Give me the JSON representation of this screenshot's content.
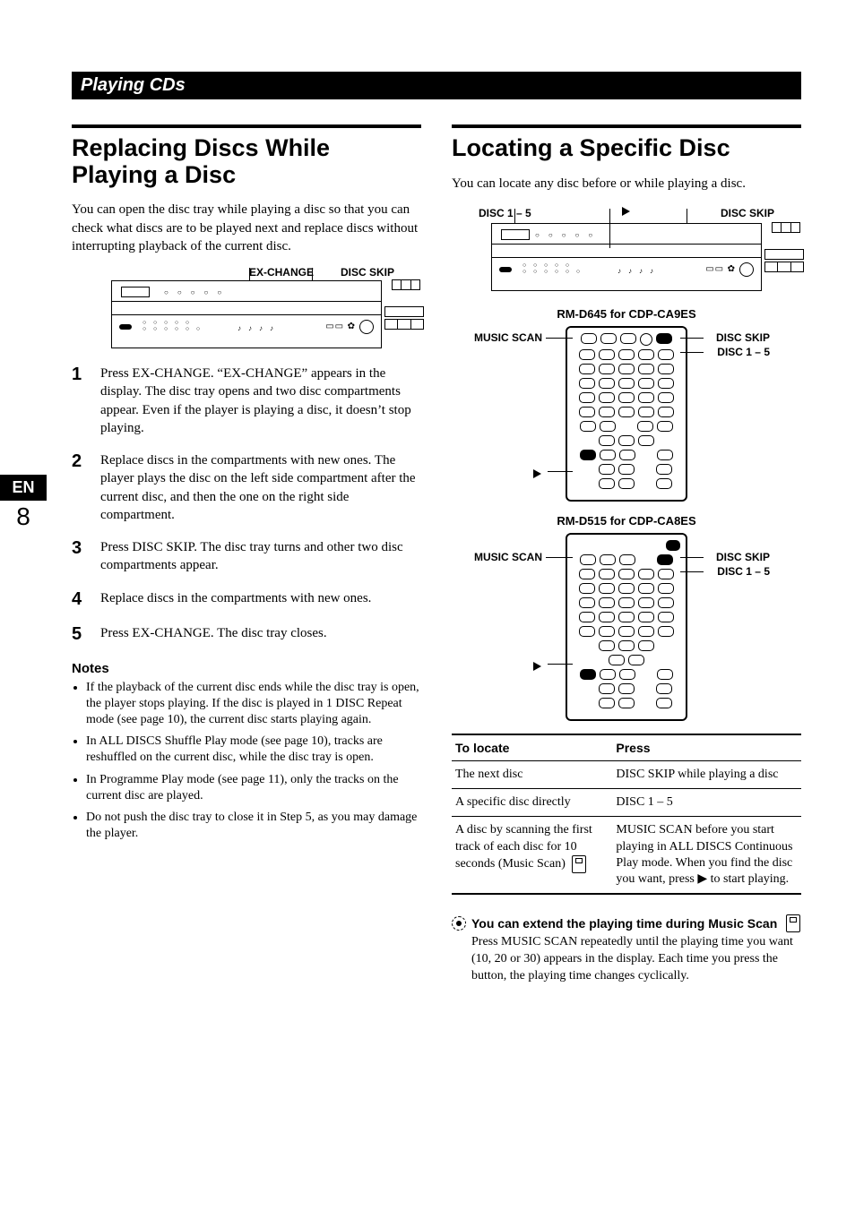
{
  "section_bar": "Playing CDs",
  "side": {
    "lang": "EN",
    "page": "8"
  },
  "left": {
    "title": "Replacing Discs While Playing a Disc",
    "intro": "You can open the disc tray while playing a disc so that you can check what discs are to be played next and replace discs without interrupting playback of the current disc.",
    "callouts": {
      "a": "EX-CHANGE",
      "b": "DISC SKIP"
    },
    "steps": [
      {
        "n": "1",
        "t": "Press EX-CHANGE.\n“EX-CHANGE” appears in the display. The disc tray opens and two disc compartments appear. Even if the player is playing a disc, it doesn’t stop playing."
      },
      {
        "n": "2",
        "t": "Replace discs in the compartments with new ones. The player plays the disc on the left side compartment after the current disc, and then the one on the right side compartment."
      },
      {
        "n": "3",
        "t": "Press DISC SKIP.\nThe disc tray turns and other two disc compartments appear."
      },
      {
        "n": "4",
        "t": "Replace discs in the compartments with new ones."
      },
      {
        "n": "5",
        "t": "Press EX-CHANGE.\nThe disc tray closes."
      }
    ],
    "notes_head": "Notes",
    "notes": [
      "If the playback of the current disc ends while the disc tray is open, the player stops playing. If the disc is played in 1 DISC Repeat mode (see page 10), the current disc starts playing again.",
      "In ALL DISCS Shuffle Play mode (see page 10), tracks are reshuffled on the current disc, while the disc tray is open.",
      "In Programme Play mode (see page 11), only the tracks on the current disc are played.",
      "Do not push the disc tray to close it in Step 5, as you may damage the player."
    ]
  },
  "right": {
    "title": "Locating a Specific Disc",
    "intro": "You can locate any disc before or while playing a disc.",
    "panel_callouts": {
      "left": "DISC 1 – 5",
      "right": "DISC SKIP"
    },
    "remote1_title": "RM-D645 for CDP-CA9ES",
    "remote2_title": "RM-D515 for CDP-CA8ES",
    "rc_labels": {
      "music_scan": "MUSIC SCAN",
      "disc_skip": "DISC SKIP",
      "disc15": "DISC 1 – 5",
      "play": "▶"
    },
    "table": {
      "head": {
        "a": "To locate",
        "b": "Press"
      },
      "rows": [
        {
          "a": "The next disc",
          "b": "DISC SKIP while playing a disc"
        },
        {
          "a": "A specific disc directly",
          "b": "DISC 1 – 5"
        },
        {
          "a": "A disc by scanning the first track of each disc for 10 seconds (Music Scan) ",
          "b": "MUSIC SCAN before you start playing in ALL DISCS Continuous Play mode. When you find the disc you want, press ▶ to start playing."
        }
      ]
    },
    "tip": {
      "head": "You can extend the playing time during Music Scan ",
      "body": "Press MUSIC SCAN repeatedly until the playing time you want (10, 20 or 30) appears in the display. Each time you press the button, the playing time changes cyclically."
    }
  }
}
